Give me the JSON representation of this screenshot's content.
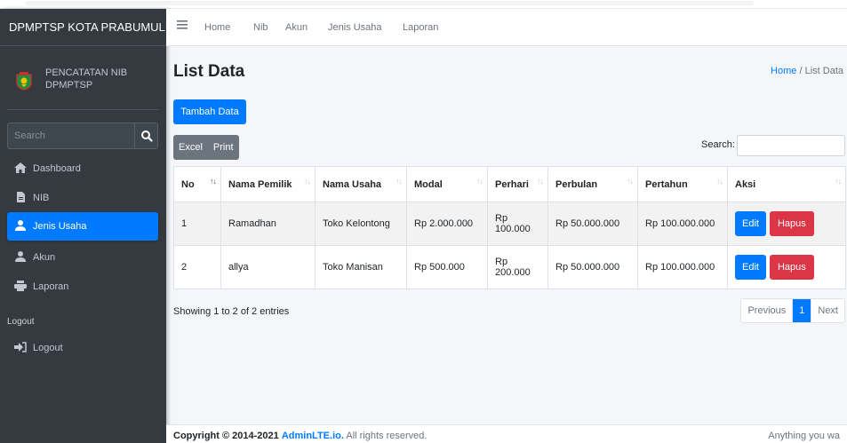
{
  "sidebar": {
    "brand": "DPMPTSP KOTA PRABUMULIH",
    "user_line1": "PENCATATAN NIB",
    "user_line2": "DPMPTSP",
    "search_placeholder": "Search",
    "items": [
      {
        "label": "Dashboard",
        "icon": "home-icon"
      },
      {
        "label": "NIB",
        "icon": "file-icon"
      },
      {
        "label": "Jenis Usaha",
        "icon": "user-icon",
        "active": true
      },
      {
        "label": "Akun",
        "icon": "users-icon"
      },
      {
        "label": "Laporan",
        "icon": "print-icon"
      }
    ],
    "header": "Logout",
    "logout_label": "Logout",
    "active_color": "#007bff"
  },
  "navbar": {
    "links": [
      "Home",
      "Nib",
      "Akun",
      "Jenis Usaha",
      "Laporan"
    ]
  },
  "page": {
    "title": "List Data",
    "breadcrumb_home": "Home",
    "breadcrumb_sep": "/",
    "breadcrumb_current": "List Data",
    "add_button": "Tambah Data",
    "excel_button": "Excel",
    "print_button": "Print",
    "search_label": "Search:",
    "search_value": ""
  },
  "table": {
    "headers": [
      "No",
      "Nama Pemilik",
      "Nama Usaha",
      "Modal",
      "Perhari",
      "Perbulan",
      "Pertahun",
      "Aksi"
    ],
    "rows": [
      [
        "1",
        "Ramadhan",
        "Toko Kelontong",
        "Rp 2.000.000",
        "Rp 100.000",
        "Rp 50.000.000",
        "Rp 100.000.000"
      ],
      [
        "2",
        "allya",
        "Toko Manisan",
        "Rp 500.000",
        "Rp 200.000",
        "Rp 50.000.000",
        "Rp 100.000.000"
      ]
    ],
    "edit_label": "Edit",
    "delete_label": "Hapus"
  },
  "pagination": {
    "info": "Showing 1 to 2 of 2 entries",
    "previous": "Previous",
    "current": "1",
    "next": "Next"
  },
  "footer": {
    "copyright": "Copyright © 2014-2021",
    "brand": "AdminLTE.io.",
    "rights": "All rights reserved.",
    "right_text": "Anything you wa"
  }
}
